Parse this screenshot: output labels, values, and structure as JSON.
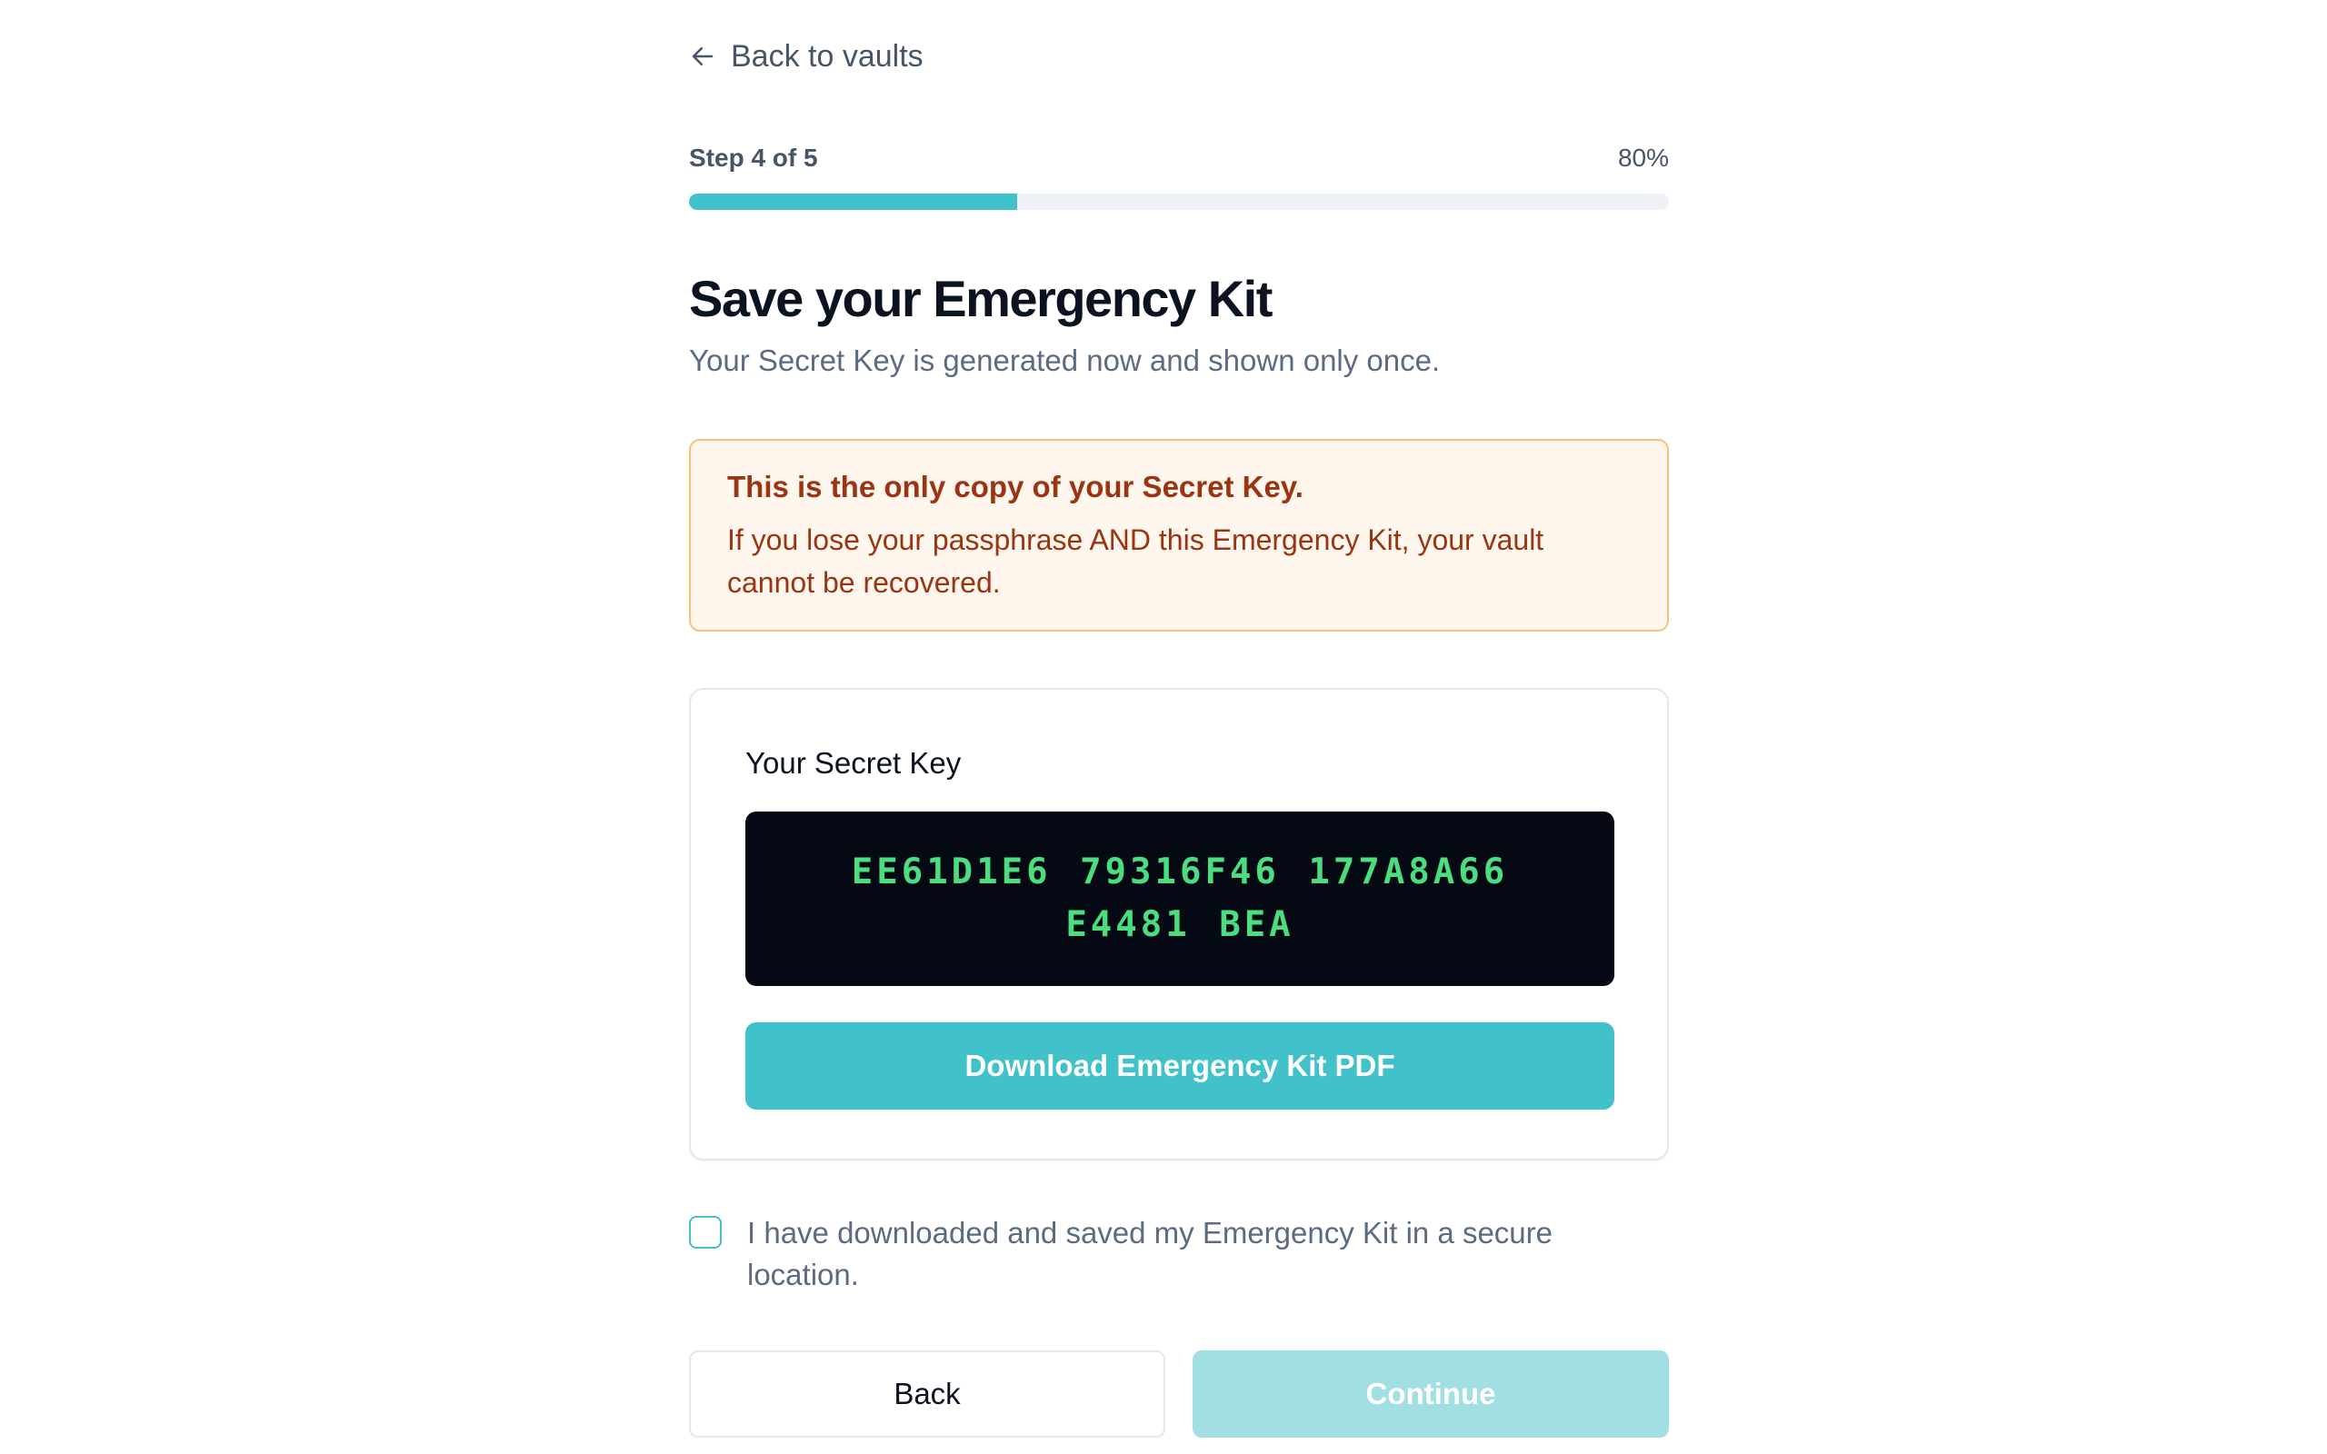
{
  "nav": {
    "back_label": "Back to vaults",
    "back_icon": "arrow-left-icon"
  },
  "progress": {
    "step_label": "Step 4 of 5",
    "percent_label": "80%",
    "fill_fraction": 0.335
  },
  "header": {
    "title": "Save your Emergency Kit",
    "subtitle": "Your Secret Key is generated now and shown only once."
  },
  "warning": {
    "title": "This is the only copy of your Secret Key.",
    "body": "If you lose your passphrase AND this Emergency Kit, your vault cannot be recovered."
  },
  "secret_key": {
    "label": "Your Secret Key",
    "value": "EE61D1E6 79316F46 177A8A66 E4481 BEA",
    "download_label": "Download Emergency Kit PDF"
  },
  "confirm": {
    "label": "I have downloaded and saved my Emergency Kit in a secure location.",
    "checked": false
  },
  "actions": {
    "back_label": "Back",
    "continue_label": "Continue"
  },
  "colors": {
    "accent": "#41c1c9",
    "accent_disabled": "#a1dfe3",
    "warning_border": "#f6c27a",
    "warning_bg": "#fff6ed",
    "warning_text": "#9a3412",
    "key_bg": "#050914",
    "key_text": "#4ade80"
  }
}
